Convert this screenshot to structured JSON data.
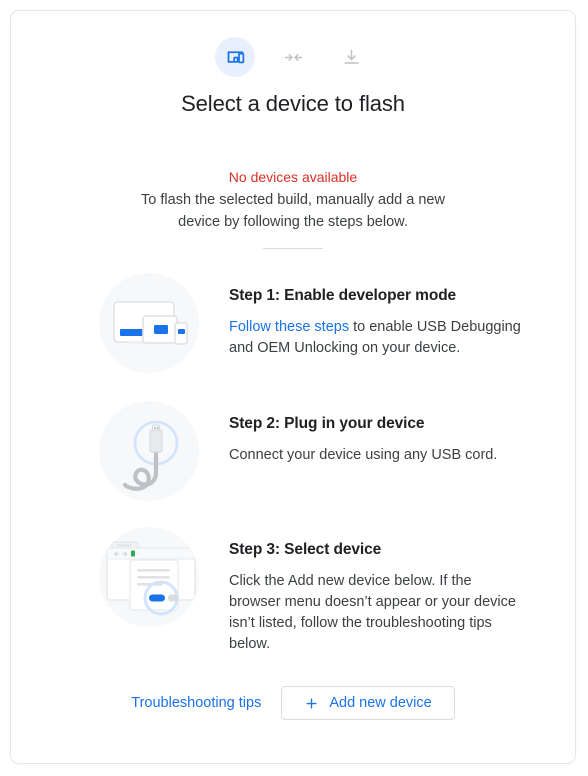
{
  "header": {
    "icons": [
      {
        "name": "devices-icon",
        "active": true
      },
      {
        "name": "merge-arrows-icon",
        "active": false
      },
      {
        "name": "download-icon",
        "active": false
      }
    ],
    "title": "Select a device to flash"
  },
  "status": {
    "error_text": "No devices available",
    "description": "To flash the selected build, manually add a new device by following the steps below."
  },
  "steps": [
    {
      "illustration": "devices-illustration",
      "title": "Step 1: Enable developer mode",
      "link_text": "Follow these steps",
      "text_after_link": " to enable USB Debugging and OEM Unlocking on your device."
    },
    {
      "illustration": "usb-cable-illustration",
      "title": "Step 2: Plug in your device",
      "text": "Connect your device using any USB cord."
    },
    {
      "illustration": "browser-dialog-illustration",
      "title": "Step 3: Select device",
      "text": "Click the Add new device below. If the browser menu doesn’t appear or your device isn’t listed, follow the troubleshooting tips below."
    }
  ],
  "footer": {
    "troubleshooting_label": "Troubleshooting tips",
    "add_device_label": "Add new device",
    "add_icon": "plus-icon"
  },
  "colors": {
    "accent": "#1a73e8",
    "error": "#d93025",
    "icon_active_bg": "#e8f0fe",
    "illustration_bg": "#f6f8fa",
    "text_primary": "#202124",
    "text_secondary": "#3c4043",
    "border": "#dadce0"
  }
}
